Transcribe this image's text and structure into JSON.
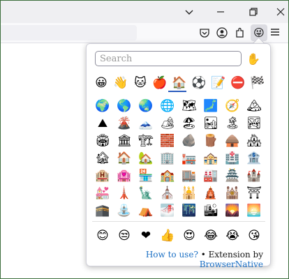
{
  "window": {
    "controls": [
      "chevron-down",
      "minimize",
      "restore",
      "close"
    ]
  },
  "toolbar": {
    "icons": [
      "pocket-icon",
      "account-icon",
      "extensions-icon",
      "emoji-extension-icon",
      "menu-icon"
    ],
    "active_extension_glyph": "😜"
  },
  "popup": {
    "search": {
      "placeholder": "Search",
      "value": ""
    },
    "skin_tone_glyph": "✋",
    "categories": [
      {
        "name": "smileys",
        "glyph": "😀"
      },
      {
        "name": "people",
        "glyph": "👋"
      },
      {
        "name": "animals",
        "glyph": "🐱"
      },
      {
        "name": "food",
        "glyph": "🍎"
      },
      {
        "name": "travel",
        "glyph": "🏠",
        "active": true
      },
      {
        "name": "activities",
        "glyph": "⚽"
      },
      {
        "name": "objects",
        "glyph": "📝"
      },
      {
        "name": "symbols",
        "glyph": "⛔"
      },
      {
        "name": "flags",
        "glyph": "🏁"
      }
    ],
    "emoji_rows": [
      [
        "🌍",
        "🌎",
        "🌏",
        "🌐",
        "🗺",
        "🗾",
        "🧭",
        "🏔"
      ],
      [
        "⛰",
        "🌋",
        "🗻",
        "🏕",
        "🏖",
        "🏜",
        "🏝",
        "🏞"
      ],
      [
        "🏟",
        "🏛",
        "🏗",
        "🧱",
        "🪨",
        "🪵",
        "🛖",
        "🏘"
      ],
      [
        "🏚",
        "🏠",
        "🏡",
        "🏢",
        "🏣",
        "🏤",
        "🏥",
        "🏦"
      ],
      [
        "🏨",
        "🏩",
        "🏪",
        "🏫",
        "🏬",
        "🏭",
        "🏯",
        "🏰"
      ],
      [
        "💒",
        "🗼",
        "🗽",
        "⛪",
        "🕌",
        "🛕",
        "🕍",
        "⛩"
      ],
      [
        "🕋",
        "⛲",
        "⛺",
        "🌁",
        "🌃",
        "🏙",
        "🌄",
        "🌅"
      ]
    ],
    "frequent": [
      "😊",
      "😒",
      "❤",
      "👍",
      "😍",
      "😂",
      "😭",
      "😘"
    ],
    "footer": {
      "how_to_use": "How to use?",
      "separator": " • Extension by ",
      "brand": "BrowserNative"
    }
  }
}
